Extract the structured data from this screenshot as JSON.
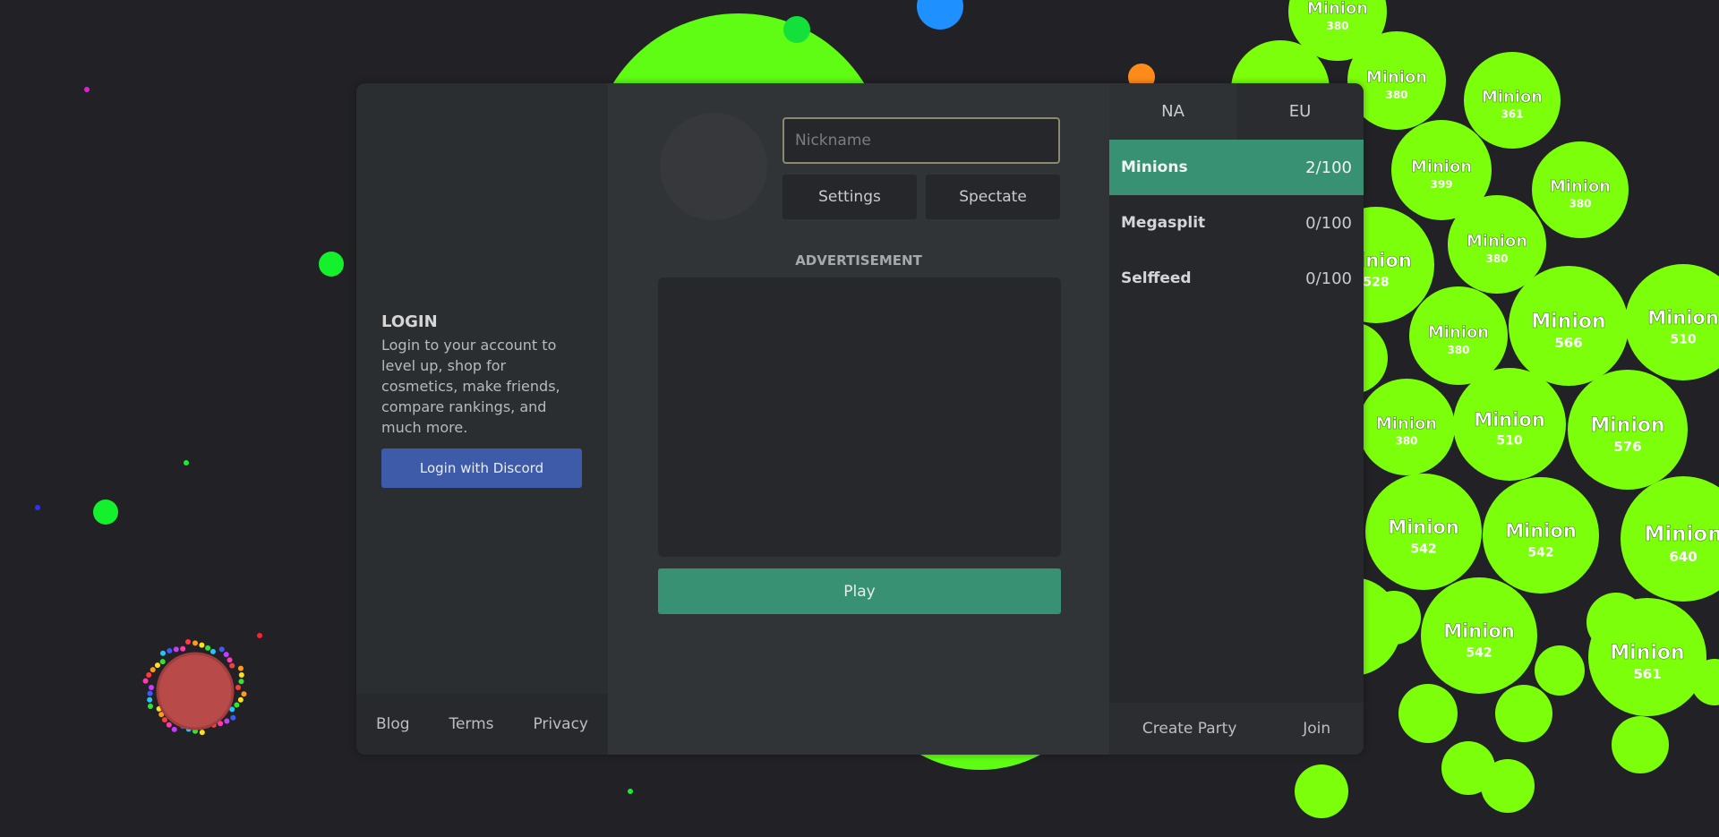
{
  "colors": {
    "background": "#222226",
    "accent": "#379172",
    "discord": "#3e5ba9",
    "minion_cell": "#7cff0a",
    "player_cell": "#b84a4a"
  },
  "login": {
    "title": "LOGIN",
    "text": "Login to your account to level up, shop for cosmetics, make friends, compare rankings, and much more.",
    "discord_button": "Login with Discord"
  },
  "footer_links": {
    "blog": "Blog",
    "terms": "Terms",
    "privacy": "Privacy"
  },
  "play_panel": {
    "nickname_placeholder": "Nickname",
    "nickname_value": "",
    "settings_label": "Settings",
    "spectate_label": "Spectate",
    "advertisement_label": "ADVERTISEMENT",
    "play_label": "Play"
  },
  "regions": {
    "na_label": "NA",
    "eu_label": "EU",
    "active": "NA"
  },
  "game_modes": [
    {
      "name": "Minions",
      "count": "2/100",
      "selected": true
    },
    {
      "name": "Megasplit",
      "count": "0/100",
      "selected": false
    },
    {
      "name": "Selffeed",
      "count": "0/100",
      "selected": false
    }
  ],
  "party": {
    "create_label": "Create Party",
    "join_label": "Join"
  },
  "game": {
    "minion_cells": [
      {
        "name": "Minion",
        "mass": "380"
      },
      {
        "name": "Minion",
        "mass": "380"
      },
      {
        "name": "Minion",
        "mass": "361"
      },
      {
        "name": "Minion",
        "mass": "399"
      },
      {
        "name": "Minion",
        "mass": "380"
      },
      {
        "name": "Minion",
        "mass": "380"
      },
      {
        "name": "Minion",
        "mass": "528"
      },
      {
        "name": "Minion",
        "mass": "380"
      },
      {
        "name": "Minion",
        "mass": "566"
      },
      {
        "name": "Minion",
        "mass": "510"
      },
      {
        "name": "Minion",
        "mass": "380"
      },
      {
        "name": "Minion",
        "mass": "510"
      },
      {
        "name": "Minion",
        "mass": "576"
      },
      {
        "name": "Minion",
        "mass": "542"
      },
      {
        "name": "Minion",
        "mass": "542"
      },
      {
        "name": "Minion",
        "mass": "640"
      },
      {
        "name": "Minion",
        "mass": "542"
      },
      {
        "name": "Minion",
        "mass": "561"
      }
    ]
  }
}
